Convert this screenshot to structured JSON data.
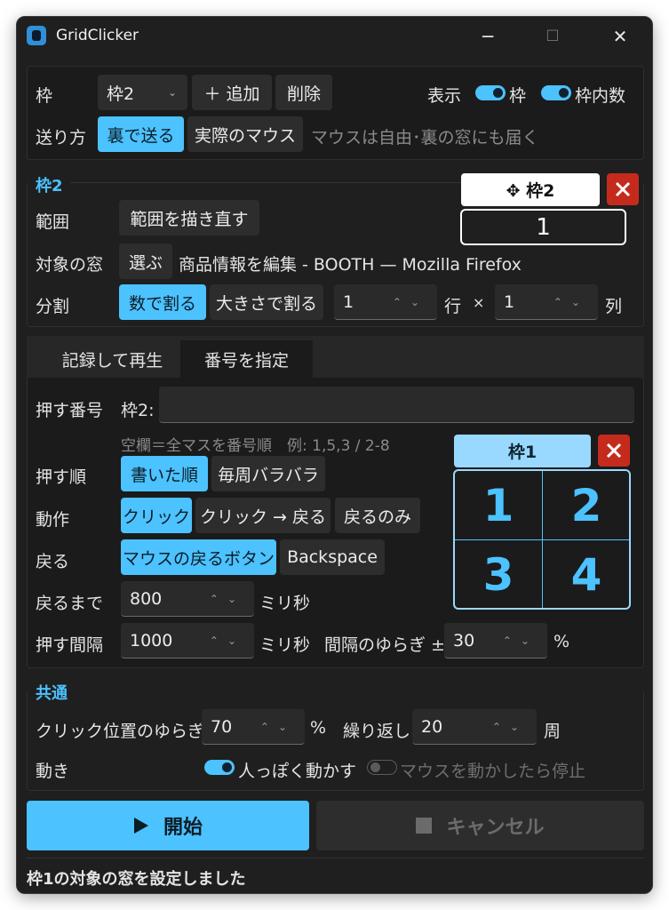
{
  "window": {
    "title": "GridClicker",
    "minimize": "─",
    "maximize": "☐",
    "close": "✕"
  },
  "top": {
    "frame_label": "枠",
    "frame_select": "枠2",
    "add_button": "＋ 追加",
    "delete_button": "削除",
    "display_label": "表示",
    "display_frame_toggle": "枠",
    "display_number_toggle": "枠内数",
    "send_label": "送り方",
    "send_background": "裏で送る",
    "send_real_mouse": "実際のマウス",
    "send_hint": "マウスは自由･裏の窓にも届く"
  },
  "frame2": {
    "section_title": "枠2",
    "range_label": "範囲",
    "redraw_button": "範囲を描き直す",
    "target_label": "対象の窓",
    "choose_button": "選ぶ",
    "target_window": "商品情報を編集 - BOOTH — Mozilla Firefox",
    "split_label": "分割",
    "split_by_count": "数で割る",
    "split_by_size": "大きさで割る",
    "rows_value": "1",
    "rows_label": "行",
    "times": "×",
    "cols_value": "1",
    "cols_label": "列",
    "preview_title": "✥ 枠2",
    "preview_number": "1"
  },
  "tabs": {
    "record": "記録して再生",
    "by_number": "番号を指定"
  },
  "numbers": {
    "press_label": "押す番号",
    "press_prefix": "枠2:",
    "press_value": "",
    "hint": "空欄＝全マスを番号順　例: 1,5,3 / 2-8",
    "order_label": "押す順",
    "order_written": "書いた順",
    "order_shuffle": "毎周バラバラ",
    "action_label": "動作",
    "action_click": "クリック",
    "action_click_back": "クリック → 戻る",
    "action_back_only": "戻るのみ",
    "back_label": "戻る",
    "back_mouse": "マウスの戻るボタン",
    "back_backspace": "Backspace",
    "until_back_label": "戻るまで",
    "until_back_value": "800",
    "ms1": "ミリ秒",
    "interval_label": "押す間隔",
    "interval_value": "1000",
    "ms2": "ミリ秒",
    "jitter_label": "間隔のゆらぎ ±",
    "jitter_value": "30",
    "percent": "%",
    "grid_title": "枠1",
    "grid_cells": [
      "1",
      "2",
      "3",
      "4"
    ]
  },
  "common": {
    "section_title": "共通",
    "pos_jitter_label": "クリック位置のゆらぎ",
    "pos_jitter_value": "70",
    "percent": "%",
    "repeat_label": "繰り返し",
    "repeat_value": "20",
    "repeat_unit": "周",
    "motion_label": "動き",
    "human_toggle": "人っぽく動かす",
    "stop_toggle": "マウスを動かしたら停止"
  },
  "actions": {
    "start": "開始",
    "cancel": "キャンセル"
  },
  "status": "枠1の対象の窓を設定しました",
  "colors": {
    "accent": "#4cc2ff",
    "danger": "#c42b1c",
    "background": "#1f1f1f"
  }
}
